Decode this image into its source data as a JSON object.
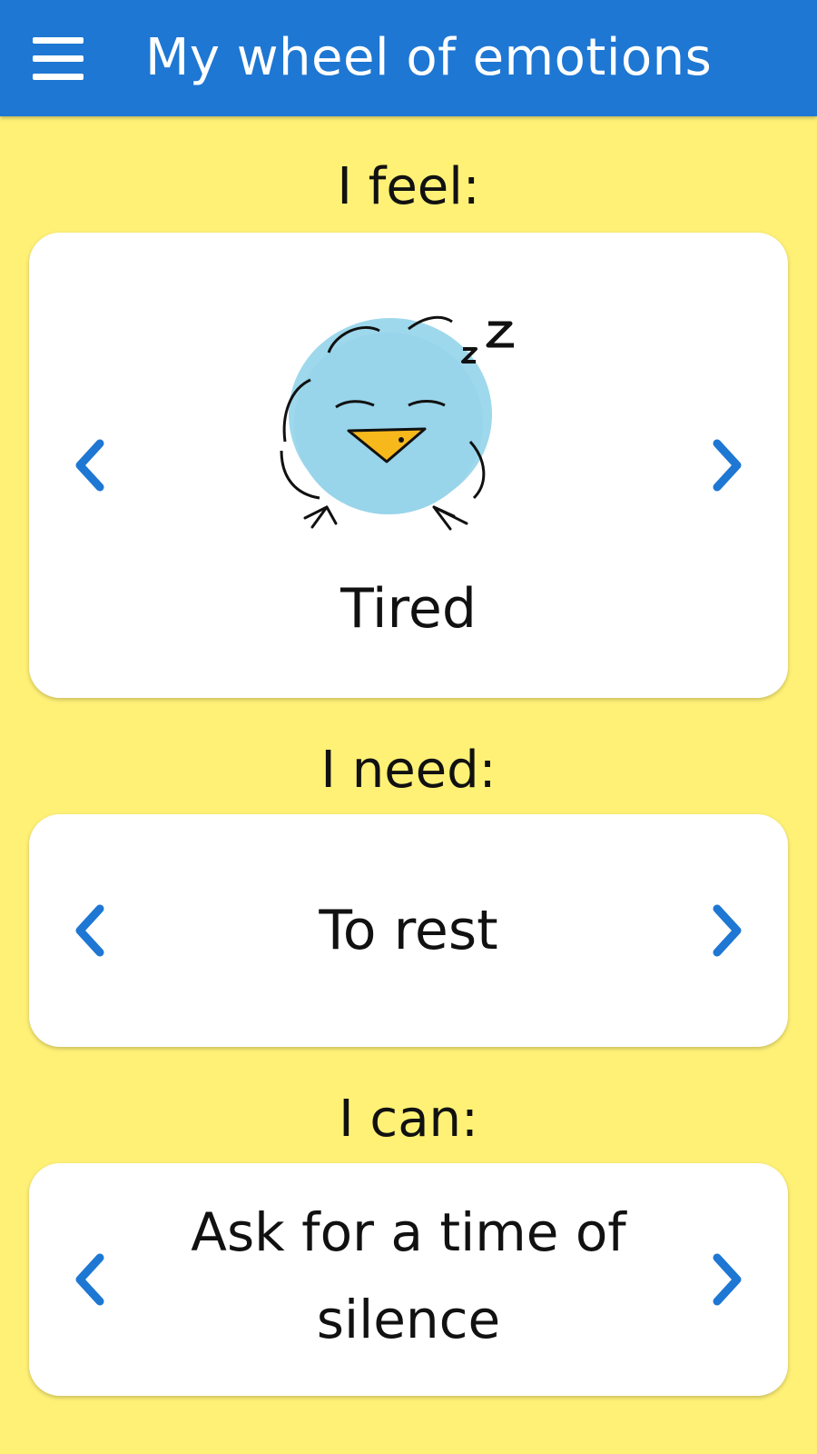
{
  "app_bar": {
    "title": "My wheel of emotions",
    "menu_icon": "hamburger-menu-icon",
    "background_color": "#1e77d3"
  },
  "feel": {
    "label": "I feel:",
    "emotion": "Tired",
    "illustration_icon": "sleeping-bird-icon"
  },
  "need": {
    "label": "I need:",
    "value": "To rest"
  },
  "can": {
    "label": "I can:",
    "value": "Ask for a time of silence"
  },
  "icons": {
    "previous": "chevron-left-icon",
    "next": "chevron-right-icon"
  },
  "colors": {
    "page_background": "#fff176",
    "accent": "#1e77d3",
    "card": "#ffffff"
  }
}
